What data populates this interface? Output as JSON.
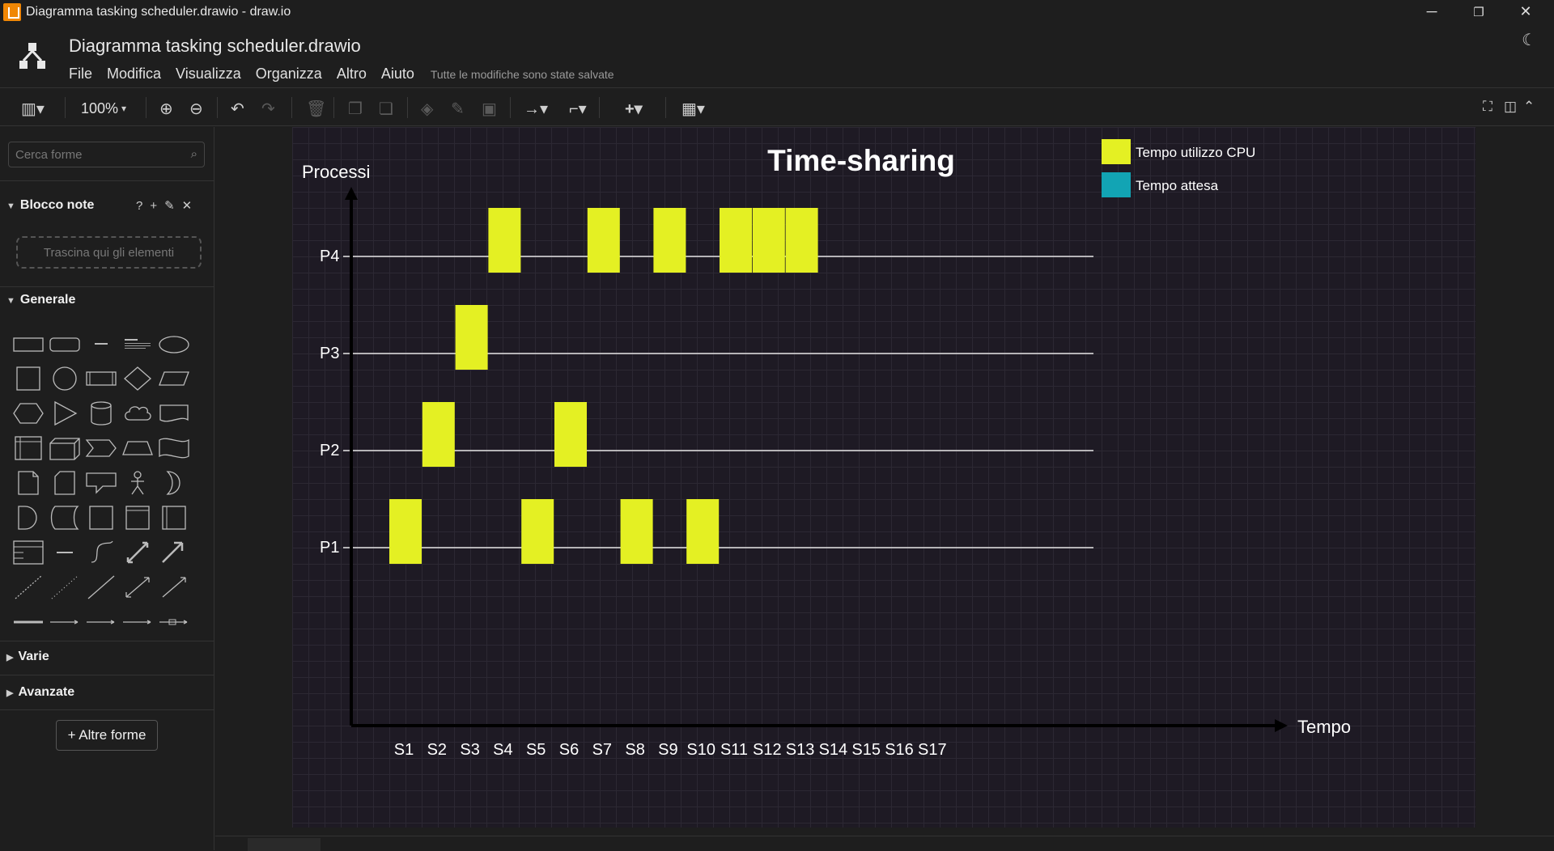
{
  "window": {
    "title": "Diagramma tasking scheduler.drawio - draw.io",
    "minimize": "─",
    "restore": "❐",
    "close": "✕"
  },
  "header": {
    "doc_title": "Diagramma tasking scheduler.drawio",
    "menu": [
      "File",
      "Modifica",
      "Visualizza",
      "Organizza",
      "Altro",
      "Aiuto"
    ],
    "save_status": "Tutte le modifiche sono state salvate"
  },
  "toolbar": {
    "zoom": "100%"
  },
  "sidebar": {
    "search_placeholder": "Cerca forme",
    "scratchpad": {
      "title": "Blocco note",
      "tools": "?+✎✕",
      "drop_hint": "Trascina qui gli elementi"
    },
    "sections": {
      "general": "Generale",
      "misc": "Varie",
      "advanced": "Avanzate"
    },
    "more_shapes": "+ Altre forme"
  },
  "colors": {
    "cpu": "#e4f023",
    "wait": "#12a4b4",
    "axis": "#000000",
    "timeline": "#e6e6e6"
  },
  "chart_data": {
    "type": "gantt",
    "title": "Time-sharing",
    "ylabel": "Processi",
    "xlabel": "Tempo",
    "slots": [
      "S1",
      "S2",
      "S3",
      "S4",
      "S5",
      "S6",
      "S7",
      "S8",
      "S9",
      "S10",
      "S11",
      "S12",
      "S13",
      "S14",
      "S15",
      "S16",
      "S17"
    ],
    "processes": [
      {
        "name": "P4",
        "cpu_slots": [
          4,
          7,
          9,
          11,
          12,
          13
        ]
      },
      {
        "name": "P3",
        "cpu_slots": [
          3
        ]
      },
      {
        "name": "P2",
        "cpu_slots": [
          2,
          6
        ]
      },
      {
        "name": "P1",
        "cpu_slots": [
          1,
          5,
          8,
          10
        ]
      }
    ],
    "legend": [
      {
        "label": "Tempo utilizzo CPU",
        "color": "#e4f023"
      },
      {
        "label": "Tempo attesa",
        "color": "#12a4b4"
      }
    ]
  }
}
